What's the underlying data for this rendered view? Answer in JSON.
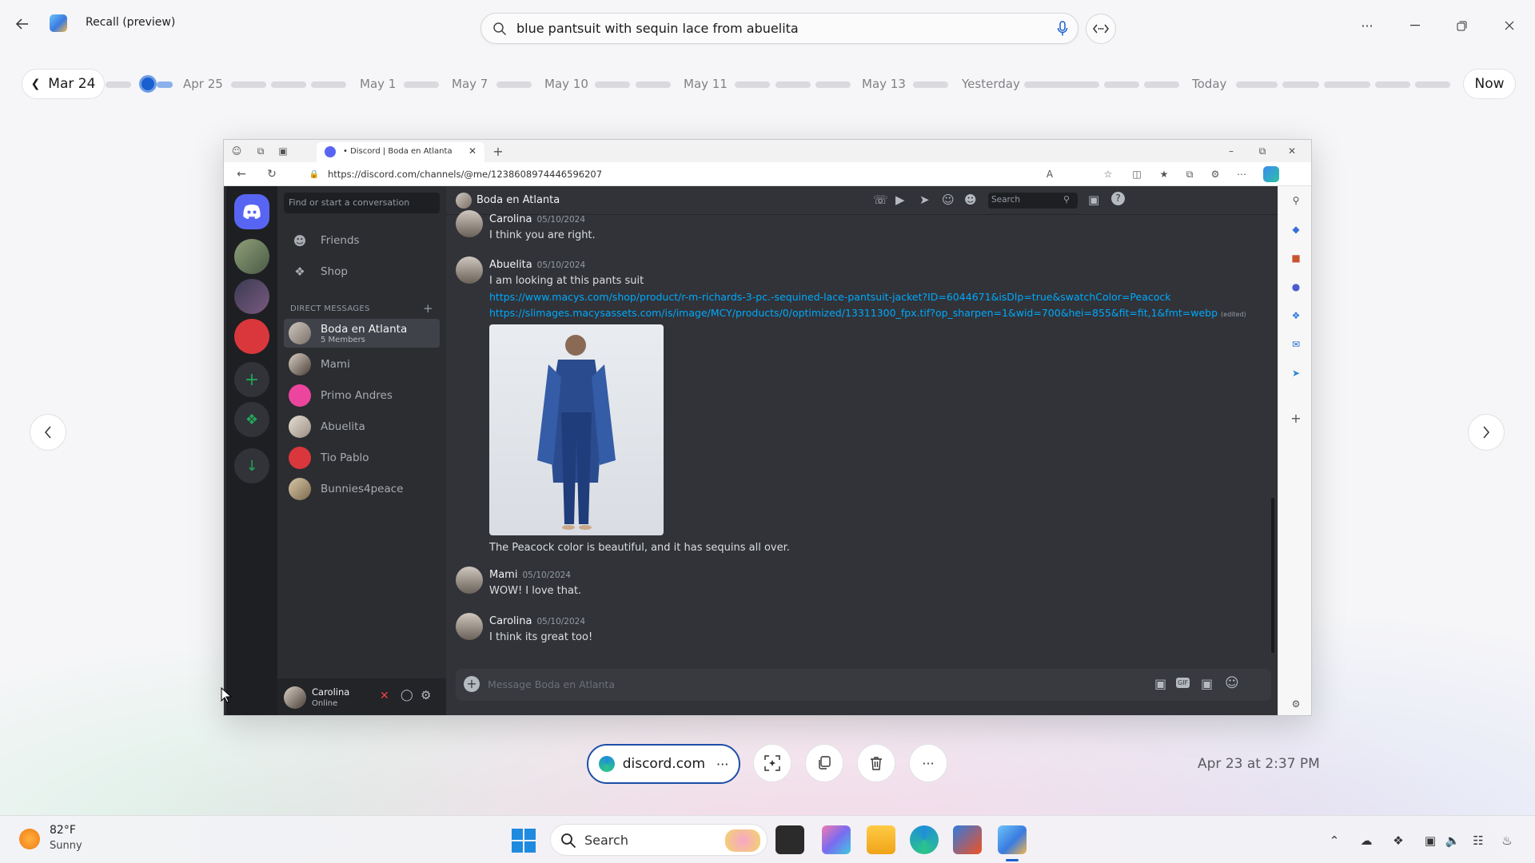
{
  "app": {
    "title": "Recall (preview)"
  },
  "search": {
    "value": "blue pantsuit with sequin lace from abuelita"
  },
  "timeline": {
    "prev_label": "Mar 24",
    "now_label": "Now",
    "labels": [
      "Apr 25",
      "May 1",
      "May 7",
      "May 10",
      "May 11",
      "May 13",
      "Yesterday",
      "Today"
    ]
  },
  "browser": {
    "tab_title": "• Discord | Boda en Atlanta",
    "url": "https://discord.com/channels/@me/1238608974446596207"
  },
  "discord": {
    "search_conversation_placeholder": "Find or start a conversation",
    "nav": {
      "friends": "Friends",
      "shop": "Shop"
    },
    "dm_header": "DIRECT MESSAGES",
    "dms": [
      {
        "name": "Boda en Atlanta",
        "sub": "5 Members"
      },
      {
        "name": "Mami"
      },
      {
        "name": "Primo Andres"
      },
      {
        "name": "Abuelita"
      },
      {
        "name": "Tio Pablo"
      },
      {
        "name": "Bunnies4peace"
      }
    ],
    "user": {
      "name": "Carolina",
      "status": "Online"
    },
    "channel_title": "Boda en Atlanta",
    "search_placeholder": "Search",
    "messages": [
      {
        "author": "Carolina",
        "time": "05/10/2024",
        "text": "I think you are right."
      },
      {
        "author": "Abuelita",
        "time": "05/10/2024",
        "text": "I am looking at this pants suit",
        "link1": "https://www.macys.com/shop/product/r-m-richards-3-pc.-sequined-lace-pantsuit-jacket?ID=6044671&isDlp=true&swatchColor=Peacock",
        "link2": "https://slimages.macysassets.com/is/image/MCY/products/0/optimized/13311300_fpx.tif?op_sharpen=1&wid=700&hei=855&fit=fit,1&fmt=webp",
        "edited": "(edited)",
        "caption": "The Peacock color is beautiful, and it has sequins all over."
      },
      {
        "author": "Mami",
        "time": "05/10/2024",
        "text": "WOW! I love that."
      },
      {
        "author": "Carolina",
        "time": "05/10/2024",
        "text": "I think its great too!"
      }
    ],
    "composer_placeholder": "Message Boda en Atlanta",
    "gif_label": "GIF"
  },
  "bottom": {
    "source_label": "discord.com",
    "timestamp": "Apr 23 at 2:37 PM"
  },
  "taskbar": {
    "temp": "82°F",
    "condition": "Sunny",
    "search_label": "Search"
  },
  "colors": {
    "accent": "#1a5fd0",
    "discord_blurple": "#5865f2",
    "link": "#00a8fc"
  }
}
